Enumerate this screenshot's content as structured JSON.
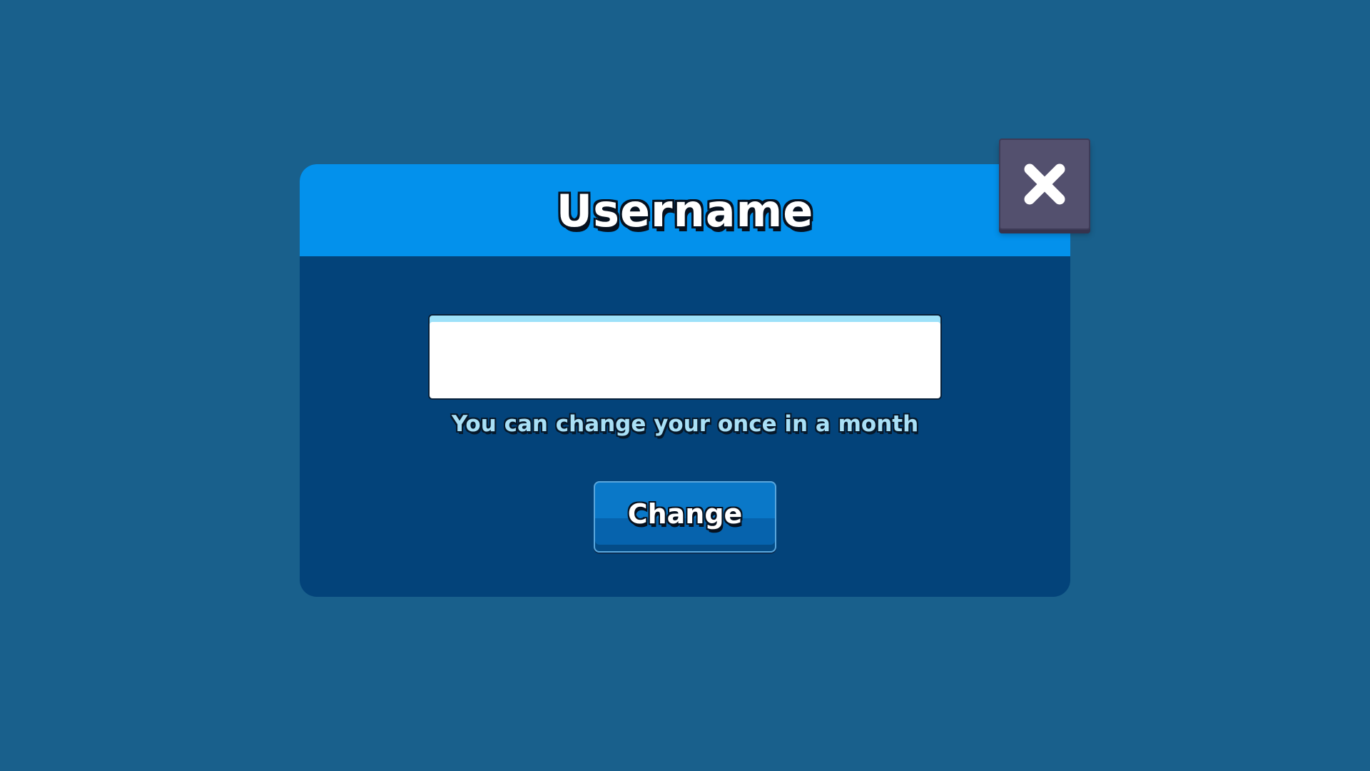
{
  "dialog": {
    "title": "Username",
    "input": {
      "value": "",
      "placeholder": ""
    },
    "hint": "You can change your once in a month",
    "change_button_label": "Change",
    "close_icon": "close-icon"
  },
  "colors": {
    "background": "#19608c",
    "dialog_body": "#03437a",
    "dialog_header": "#0391ec",
    "close_button": "#53506e",
    "hint_text": "#a9e0f6",
    "button": "#0a78c8"
  }
}
